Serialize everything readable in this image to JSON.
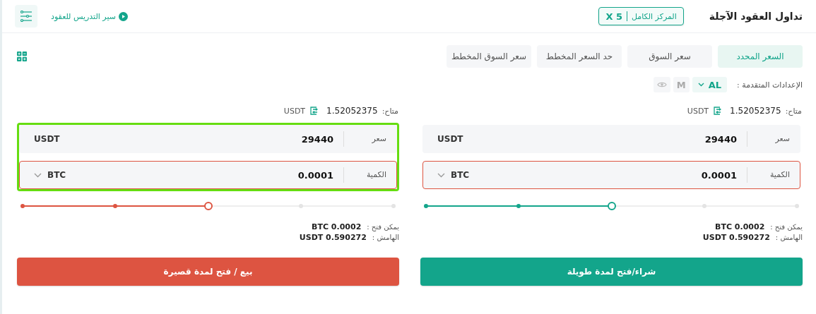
{
  "header": {
    "title": "تداول العقود الآجلة",
    "margin_mode": {
      "label": "المركز الكامل",
      "leverage": "X 5"
    },
    "tutorial_link": "سير التدريس للعقود"
  },
  "order_types": [
    {
      "label": "السعر المحدد",
      "selected": true
    },
    {
      "label": "سعر السوق",
      "selected": false
    },
    {
      "label": "حد السعر المخطط",
      "selected": false
    },
    {
      "label": "سعر السوق المخطط",
      "selected": false
    }
  ],
  "advanced_settings": {
    "label": "الإعدادات المتقدمة :",
    "options": [
      {
        "kind": "dropdown",
        "label": "AL",
        "selected": true
      },
      {
        "kind": "toggle",
        "label": "M",
        "selected": false
      },
      {
        "kind": "eye",
        "selected": false
      }
    ]
  },
  "forms": [
    {
      "kind": "buy",
      "highlighted": false,
      "available_label": "متاح:",
      "available_value": "1.52052375",
      "available_unit": "USDT",
      "price_label": "سعر",
      "price_value": "29440",
      "price_unit": "USDT",
      "quantity_label": "الكمية",
      "quantity_value": "0.0001",
      "quantity_unit": "BTC",
      "quantity_invalid": true,
      "level": 0.5,
      "can_open_label": "يمكن فتح :",
      "can_open_value": "BTC 0.0002",
      "margin_label": "الهامش :",
      "margin_value": "USDT 0.590272",
      "button": "شراء/فتح لمدة طويلة"
    },
    {
      "kind": "sell",
      "highlighted": true,
      "available_label": "متاح:",
      "available_value": "1.52052375",
      "available_unit": "USDT",
      "price_label": "سعر",
      "price_value": "29440",
      "price_unit": "USDT",
      "quantity_label": "الكمية",
      "quantity_value": "0.0001",
      "quantity_unit": "BTC",
      "quantity_invalid": true,
      "level": 0.5,
      "can_open_label": "يمكن فتح :",
      "can_open_value": "BTC 0.0002",
      "margin_label": "الهامش :",
      "margin_value": "USDT 0.590272",
      "button": "بيع / فتح لمدة قصيرة"
    }
  ]
}
